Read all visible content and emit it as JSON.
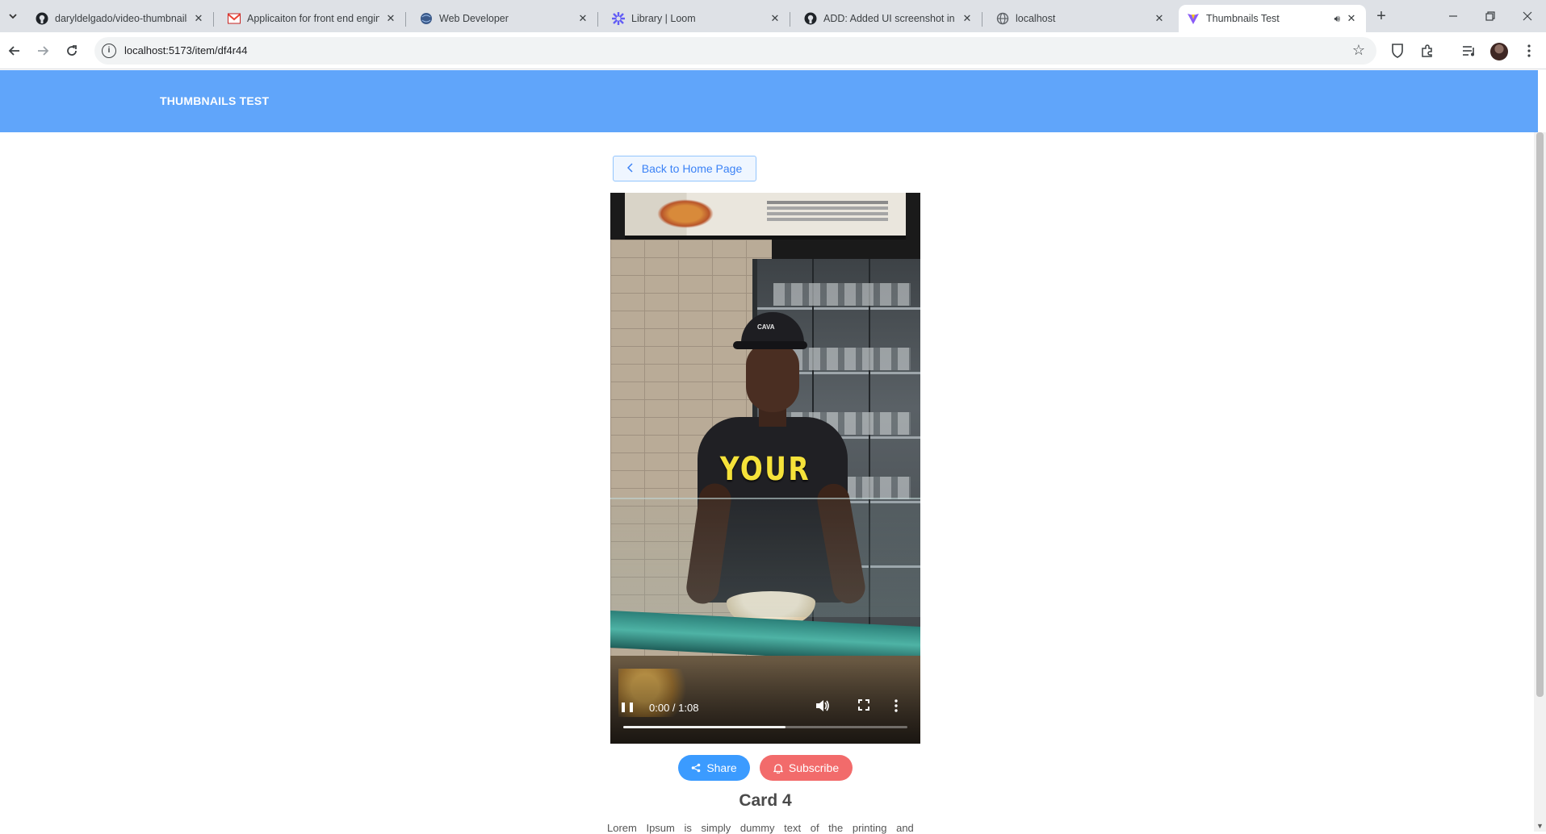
{
  "browser": {
    "tabs": [
      {
        "title": "daryldelgado/video-thumbnails",
        "icon": "github-icon",
        "active": false
      },
      {
        "title": "Applicaiton for front end engin",
        "icon": "gmail-icon",
        "active": false
      },
      {
        "title": "Web Developer",
        "icon": "globe-icon",
        "active": false
      },
      {
        "title": "Library | Loom",
        "icon": "loom-icon",
        "active": false
      },
      {
        "title": "ADD: Added UI screenshot in re",
        "icon": "github-icon",
        "active": false
      },
      {
        "title": "localhost",
        "icon": "globe-icon",
        "active": false
      },
      {
        "title": "Thumbnails Test",
        "icon": "vite-icon",
        "active": true,
        "audio": true
      }
    ],
    "url": "localhost:5173/item/df4r44"
  },
  "app": {
    "title": "THUMBNAILS TEST"
  },
  "page": {
    "back_label": "Back to Home Page",
    "video": {
      "caption": "YOUR",
      "cap_text": "CAVA",
      "time": "0:00 / 1:08",
      "buffered": 0.57
    },
    "share_label": "Share",
    "subscribe_label": "Subscribe",
    "card_title": "Card 4",
    "card_desc": "Lorem Ipsum is simply dummy text of the printing and"
  },
  "colors": {
    "header": "#60a5fa",
    "share": "#3b9bff",
    "subscribe": "#f26b6b",
    "back_border": "#93c5fd"
  }
}
